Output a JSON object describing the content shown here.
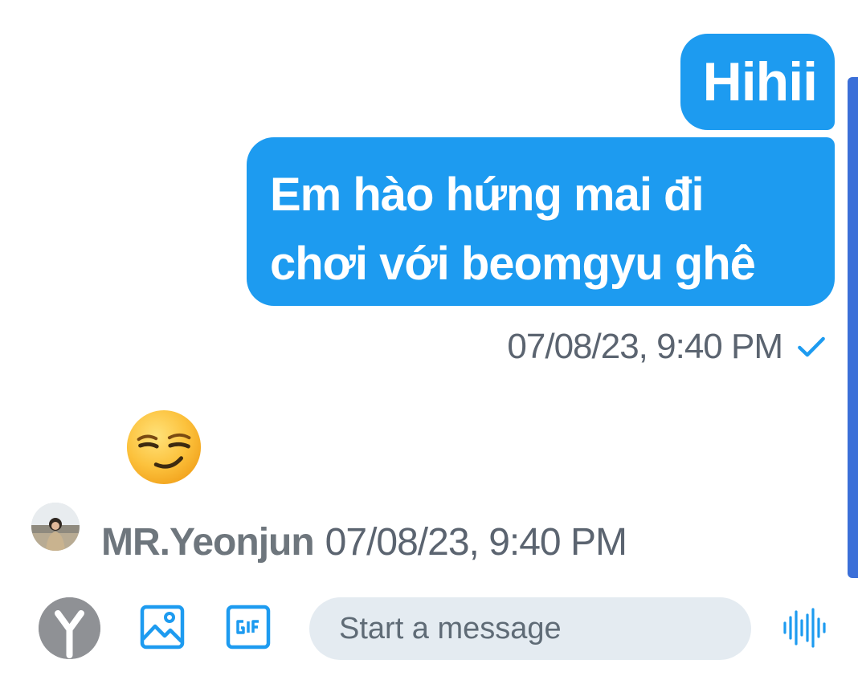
{
  "conversation": {
    "sent_messages": [
      {
        "lines": [
          "Hihii"
        ]
      },
      {
        "lines": [
          "Em hào hứng mai đi",
          "chơi với beomgyu ghê"
        ]
      }
    ],
    "sent_timestamp": "07/08/23, 9:40 PM",
    "received_message": {
      "content_icon": "smirking-face-emoji",
      "sender_name": "MR.Yeonjun",
      "timestamp": "07/08/23, 9:40 PM"
    }
  },
  "composer": {
    "placeholder": "Start a message",
    "icons": [
      "avatar-y",
      "image-icon",
      "gif-icon",
      "voice-waveform-icon"
    ]
  },
  "colors": {
    "bubble": "#1d9bf0",
    "accent": "#1d9bf0",
    "scrollbar": "#3b6fd8",
    "input_background": "#e4ebf1"
  }
}
